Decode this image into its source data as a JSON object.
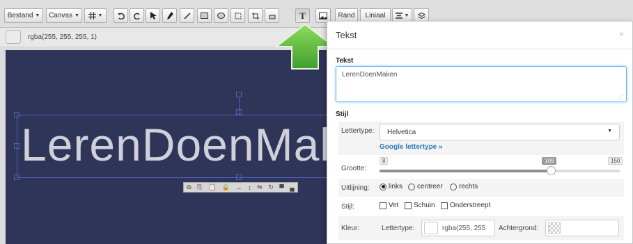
{
  "toolbar": {
    "file_menu": "Bestand",
    "canvas_menu": "Canvas",
    "border_button": "Rand",
    "ruler_button": "Liniaal",
    "icons": [
      "grid-icon",
      "undo-icon",
      "redo-icon",
      "pointer-icon",
      "pen-icon",
      "line-icon",
      "rectangle-icon",
      "ellipse-icon",
      "select-region-icon",
      "crop-icon",
      "eraser-icon",
      "text-icon",
      "image-icon",
      "align-icon",
      "layers-icon"
    ]
  },
  "colorbar": {
    "value": "rgba(255, 255, 255, 1)"
  },
  "canvas": {
    "text": "LerenDoenMaken",
    "background": "#2f3459",
    "mini_toolbar_icons": [
      "copy-icon",
      "duplicate-icon",
      "paste-icon",
      "lock-icon",
      "width-icon",
      "height-icon",
      "flip-icon",
      "rotate-icon",
      "bring-front-icon",
      "send-back-icon"
    ]
  },
  "dialog": {
    "title": "Tekst",
    "close": "×",
    "text_section": "Tekst",
    "text_value": "LerenDoenMaken",
    "style_section": "Stijl",
    "font_label": "Lettertype:",
    "font_value": "Helvetica",
    "google_font_link": "Google lettertype »",
    "size_label": "Grootte:",
    "size_min": "8",
    "size_value": "109",
    "size_max": "150",
    "size_fraction": 0.71,
    "align_label": "Uitlijning:",
    "align_options": [
      "links",
      "centreer",
      "rechts"
    ],
    "align_selected": "links",
    "style_label": "Stijl:",
    "style_options": [
      "Vet",
      "Schuin",
      "Onderstreept"
    ],
    "color_label": "Kleur:",
    "font_color_label": "Lettertype:",
    "font_color_value": "rgba(255, 255",
    "background_label": "Achtergrond:"
  },
  "colors": {
    "accent_arrow": "#5bbd3a",
    "link": "#2a7ab8",
    "focus": "#66afe9"
  }
}
